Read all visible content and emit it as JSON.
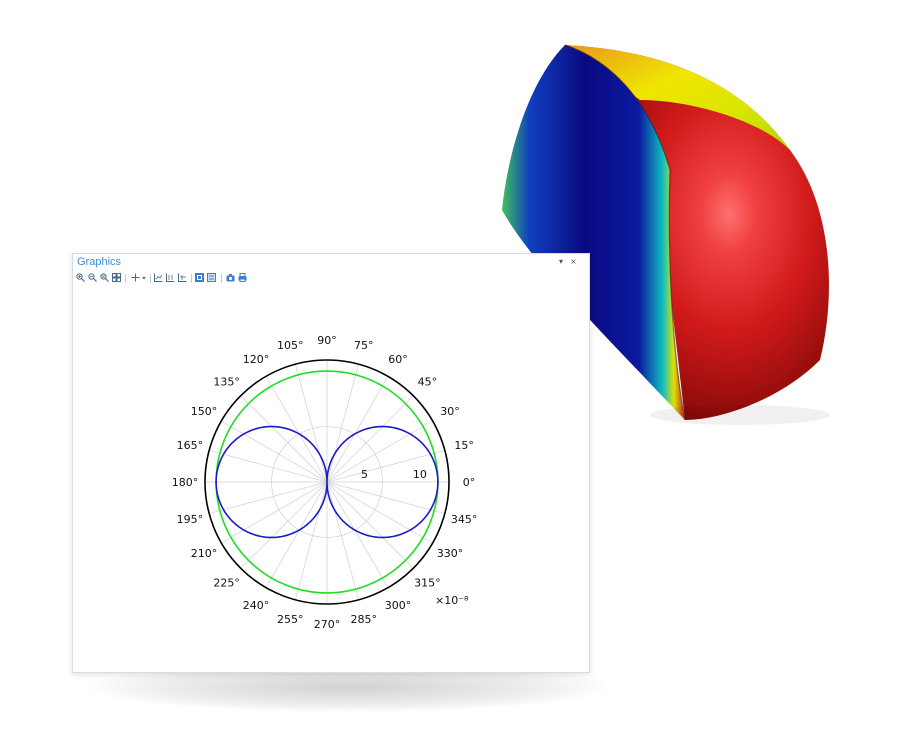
{
  "window": {
    "title": "Graphics",
    "controls": {
      "dropdown": "▾",
      "close": "×"
    }
  },
  "toolbar": {
    "tools": [
      "zoom-in-icon",
      "zoom-out-icon",
      "zoom-box-icon",
      "zoom-extents-icon",
      "select-icon",
      "dropdown-icon",
      "axis-x-icon",
      "axis-y-icon",
      "axis-xy-icon",
      "toggle-grid-icon",
      "toggle-legend-icon",
      "camera-icon",
      "print-icon"
    ]
  },
  "chart_data": {
    "type": "polar",
    "angle_ticks": [
      "0°",
      "15°",
      "30°",
      "45°",
      "60°",
      "75°",
      "90°",
      "105°",
      "120°",
      "135°",
      "150°",
      "165°",
      "180°",
      "195°",
      "210°",
      "225°",
      "240°",
      "255°",
      "270°",
      "285°",
      "300°",
      "315°",
      "330°",
      "345°"
    ],
    "radial_ticks": [
      "5",
      "10"
    ],
    "radial_max": 11,
    "scale_label": "×10⁻⁸",
    "series": [
      {
        "color": "#22dd22",
        "kind": "circle",
        "r": 10
      },
      {
        "color": "#1a1acc",
        "kind": "dipole",
        "r_max": 10
      }
    ],
    "colors": {
      "outer_ring": "#000000",
      "grid": "#cfcfcf"
    }
  },
  "model_render": {
    "colormap": "rainbow",
    "colors": {
      "low": "#0a0a7a",
      "mid": "#f0f000",
      "high": "#cc1010"
    }
  }
}
